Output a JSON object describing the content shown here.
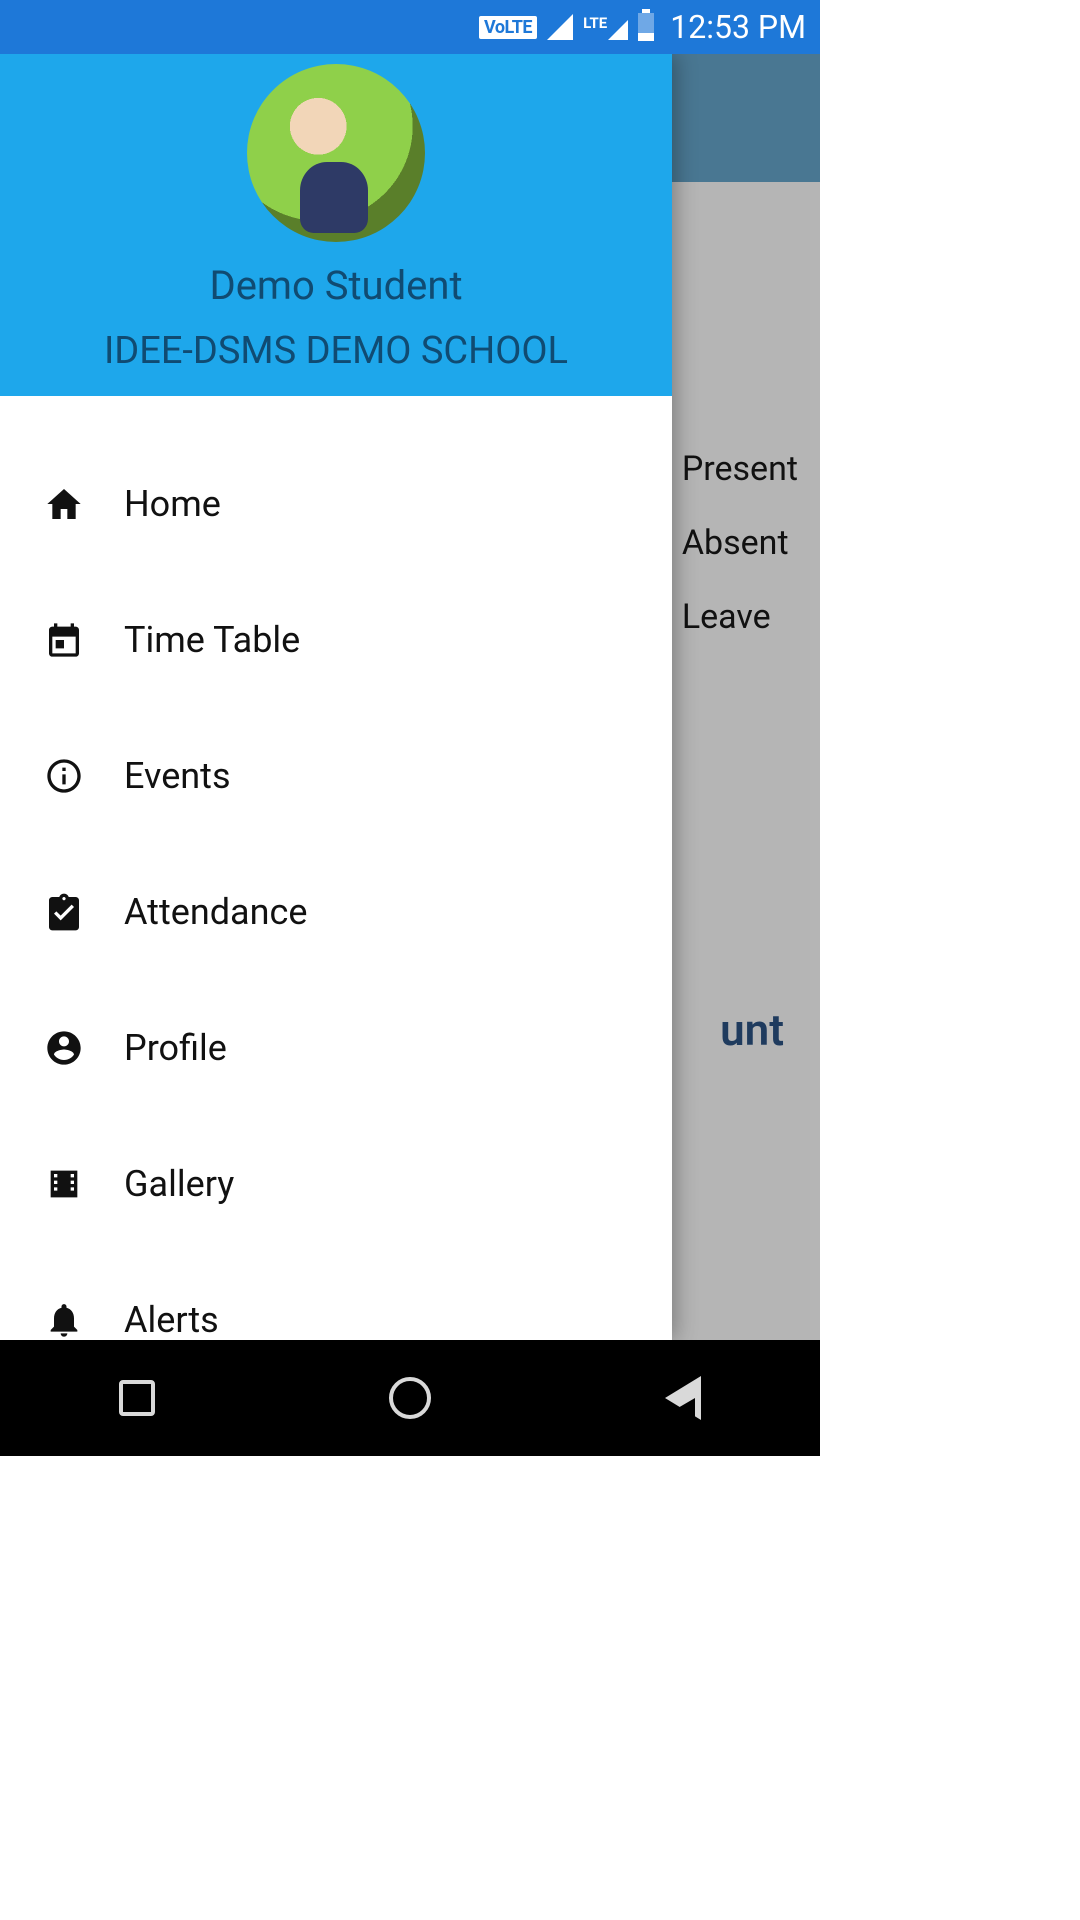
{
  "status_bar": {
    "volte_label": "VoLTE",
    "lte_label": "LTE",
    "time": "12:53 PM"
  },
  "drawer": {
    "student_name": "Demo Student",
    "school_name": "IDEE-DSMS DEMO SCHOOL",
    "items": [
      {
        "icon": "home",
        "label": "Home"
      },
      {
        "icon": "calendar",
        "label": "Time Table"
      },
      {
        "icon": "info",
        "label": "Events"
      },
      {
        "icon": "clipboard",
        "label": "Attendance"
      },
      {
        "icon": "person",
        "label": "Profile"
      },
      {
        "icon": "film",
        "label": "Gallery"
      },
      {
        "icon": "bell",
        "label": "Alerts"
      }
    ]
  },
  "background": {
    "legend": [
      {
        "color": "#2e7d32",
        "label": "Present"
      },
      {
        "color": "#c94a4a",
        "label": "Absent"
      },
      {
        "color": "#c7cc2e",
        "label": "Leave"
      }
    ],
    "partial_text": "unt"
  },
  "colors": {
    "status_bar": "#1e78d8",
    "drawer_header": "#1ea7eb",
    "underlay_bar": "#0c4a6e"
  }
}
